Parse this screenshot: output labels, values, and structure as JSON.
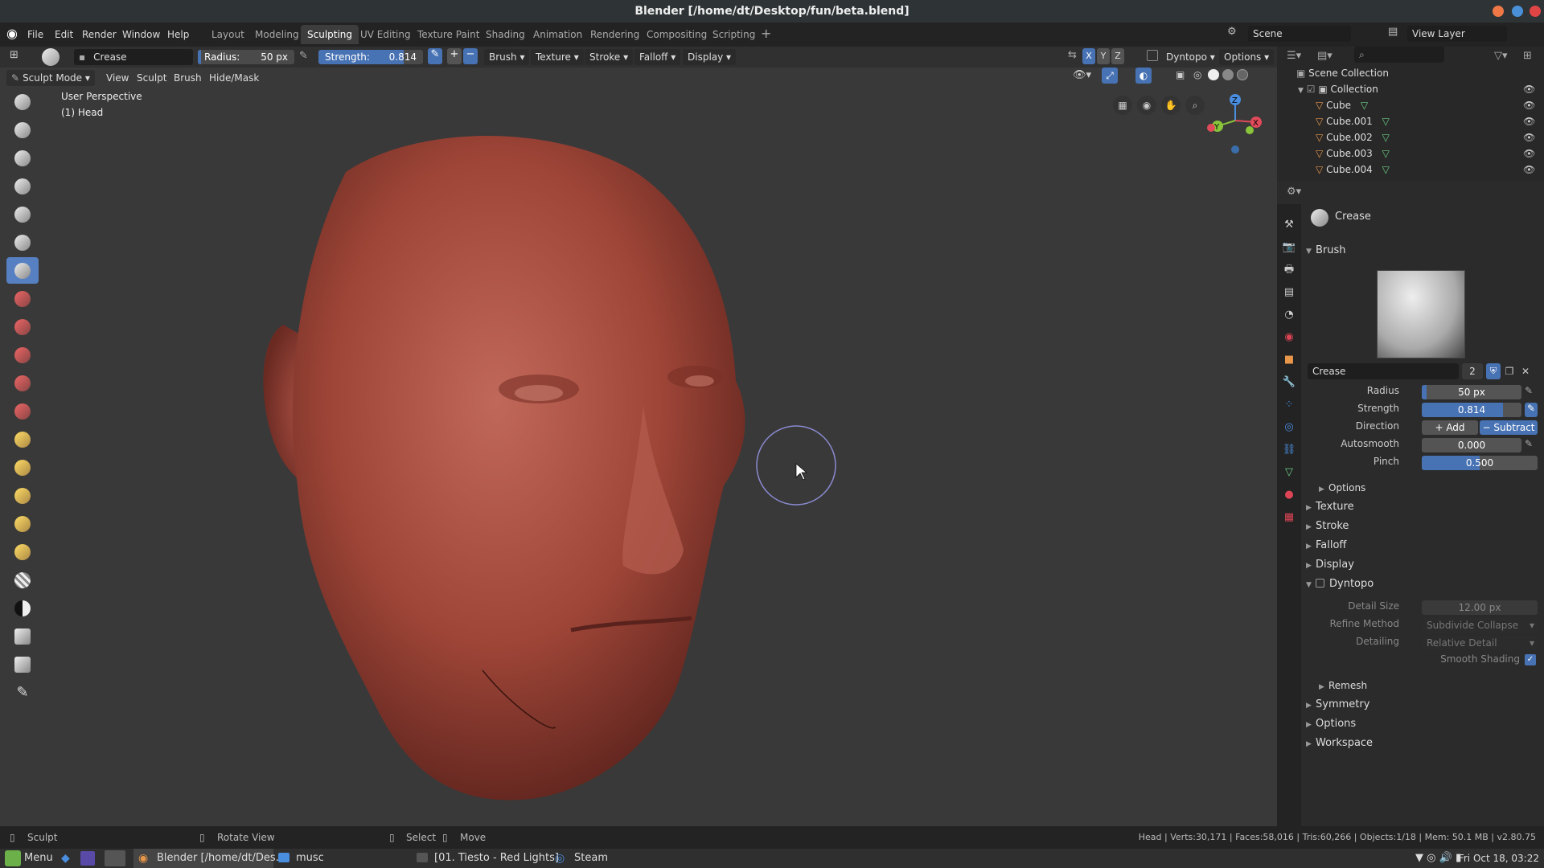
{
  "window": {
    "title": "Blender [/home/dt/Desktop/fun/beta.blend]"
  },
  "menu": [
    "File",
    "Edit",
    "Render",
    "Window",
    "Help"
  ],
  "workspaces": [
    "Layout",
    "Modeling",
    "Sculpting",
    "UV Editing",
    "Texture Paint",
    "Shading",
    "Animation",
    "Rendering",
    "Compositing",
    "Scripting"
  ],
  "active_workspace": "Sculpting",
  "scene": {
    "name": "Scene",
    "view_layer": "View Layer"
  },
  "tool_header": {
    "brush_name": "Crease",
    "radius_label": "Radius:",
    "radius_value": "50 px",
    "strength_label": "Strength:",
    "strength_value": "0.814",
    "dropdowns": [
      "Brush",
      "Texture",
      "Stroke",
      "Falloff",
      "Display"
    ],
    "axes": [
      "X",
      "Y",
      "Z"
    ],
    "dyntopo": "Dyntopo",
    "options": "Options"
  },
  "mode_header": {
    "mode": "Sculpt Mode",
    "items": [
      "View",
      "Sculpt",
      "Brush",
      "Hide/Mask"
    ]
  },
  "viewport": {
    "perspective": "User Perspective",
    "object": "(1) Head"
  },
  "outliner": {
    "root": "Scene Collection",
    "collection": "Collection",
    "objects": [
      "Cube",
      "Cube.001",
      "Cube.002",
      "Cube.003",
      "Cube.004"
    ]
  },
  "properties": {
    "brush_header": "Crease",
    "brush_panel": "Brush",
    "brush_field": "Crease",
    "brush_users": "2",
    "radius": {
      "label": "Radius",
      "value": "50 px",
      "fraction": 0.05
    },
    "strength": {
      "label": "Strength",
      "value": "0.814",
      "fraction": 0.814
    },
    "direction": {
      "label": "Direction",
      "add": "Add",
      "subtract": "Subtract"
    },
    "autosmooth": {
      "label": "Autosmooth",
      "value": "0.000",
      "fraction": 0
    },
    "pinch": {
      "label": "Pinch",
      "value": "0.500",
      "fraction": 0.5
    },
    "options_sub": "Options",
    "panels": [
      "Texture",
      "Stroke",
      "Falloff",
      "Display"
    ],
    "dyntopo": {
      "title": "Dyntopo",
      "detail_size_label": "Detail Size",
      "detail_size": "12.00 px",
      "refine_label": "Refine Method",
      "refine": "Subdivide Collapse",
      "detailing_label": "Detailing",
      "detailing": "Relative Detail",
      "smooth_label": "Smooth Shading"
    },
    "remesh": "Remesh",
    "panels_bottom": [
      "Symmetry",
      "Options",
      "Workspace"
    ]
  },
  "statusbar": {
    "left": "Sculpt",
    "rotate": "Rotate View",
    "select": "Select",
    "move": "Move",
    "stats": "Head | Verts:30,171 | Faces:58,016 | Tris:60,266 | Objects:1/18 | Mem: 50.1 MB | v2.80.75"
  },
  "taskbar": {
    "menu": "Menu",
    "blender": "Blender [/home/dt/Des...",
    "musc": "musc",
    "music": "[01. Tiesto - Red Lights]",
    "steam": "Steam",
    "clock": "Fri Oct 18, 03:22"
  },
  "colors": {
    "accent": "#4772b3",
    "skin": "#a24a3e",
    "viewport_bg": "#393939"
  }
}
